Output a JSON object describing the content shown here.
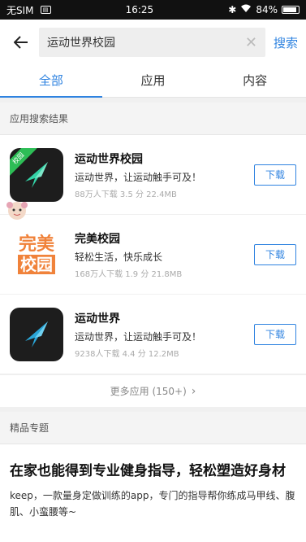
{
  "status_bar": {
    "carrier": "无SIM",
    "time": "16:25",
    "battery": "84%"
  },
  "search": {
    "value": "运动世界校园",
    "button_label": "搜索"
  },
  "tabs": [
    {
      "label": "全部",
      "active": true
    },
    {
      "label": "应用",
      "active": false
    },
    {
      "label": "内容",
      "active": false
    }
  ],
  "app_results": {
    "header": "应用搜索结果",
    "items": [
      {
        "name": "运动世界校园",
        "desc": "运动世界，让运动触手可及！",
        "meta": "88万人下载  3.5 分  22.4MB",
        "button": "下载",
        "badge": "校园",
        "icon": "sport-world-campus-logo"
      },
      {
        "name": "完美校园",
        "desc": "轻松生活，快乐成长",
        "meta": "168万人下载  1.9 分  21.8MB",
        "button": "下载",
        "icon": "perfect-campus-logo",
        "icon_text_top": "完美",
        "icon_text_bottom": "校园"
      },
      {
        "name": "运动世界",
        "desc": "运动世界，让运动触手可及！",
        "meta": "9238人下载  4.4 分  12.2MB",
        "button": "下载",
        "icon": "sport-world-logo"
      }
    ],
    "more_label": "更多应用 (150+)",
    "more_arrow": "›"
  },
  "featured": {
    "header": "精品专题",
    "title": "在家也能得到专业健身指导，轻松塑造好身材",
    "body": "keep，一款量身定做训练的app，专门的指导帮你练成马甲线、腹肌、小蛮腰等~"
  },
  "colors": {
    "accent": "#2f83e0",
    "badge_green": "#2dbd56",
    "perfect_orange": "#f0823a"
  }
}
